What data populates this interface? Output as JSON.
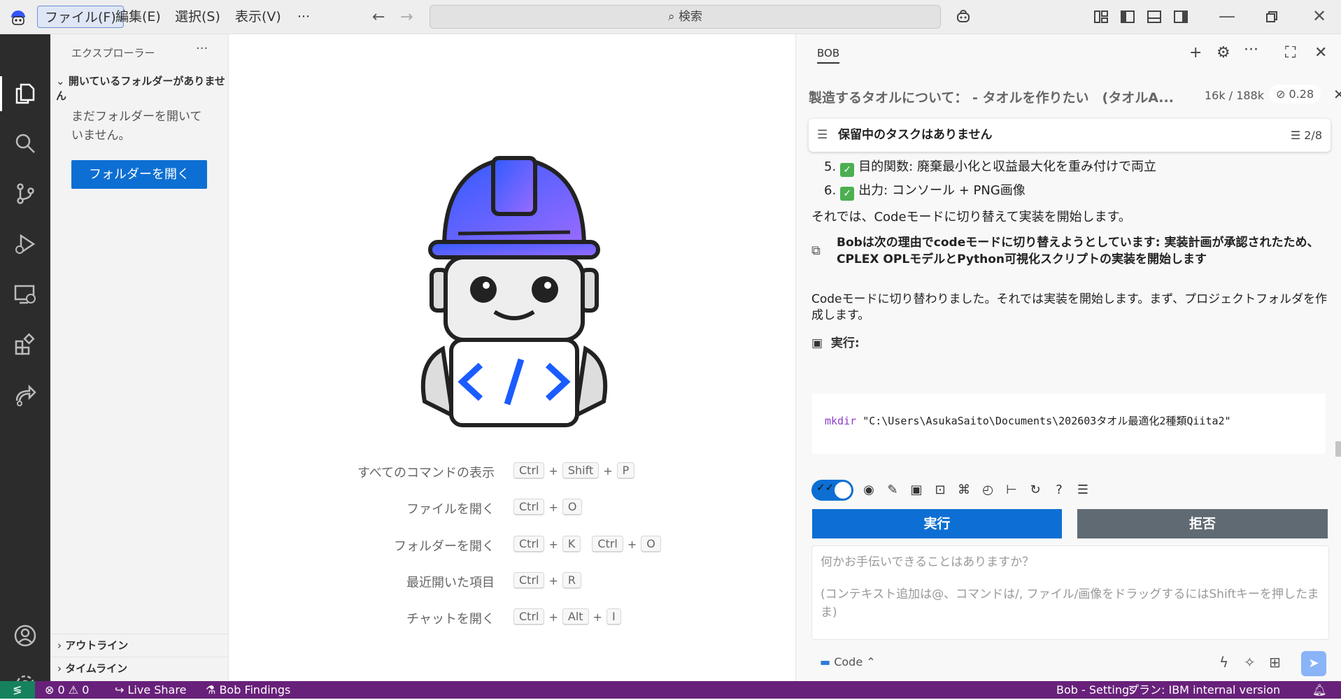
{
  "titlebar": {
    "menus": [
      "ファイル(F)",
      "編集(E)",
      "選択(S)",
      "表示(V)"
    ],
    "more": "···",
    "search_placeholder": "検索"
  },
  "sidebar": {
    "title": "エクスプローラー",
    "more": "···",
    "section": "開いているフォルダーがありません",
    "message": "まだフォルダーを開いていません。",
    "open_folder_button": "フォルダーを開く",
    "outline": "アウトライン",
    "timeline": "タイムライン"
  },
  "editor": {
    "shortcuts": [
      {
        "label": "すべてのコマンドの表示",
        "keys": [
          "Ctrl",
          "+",
          "Shift",
          "+",
          "P"
        ]
      },
      {
        "label": "ファイルを開く",
        "keys": [
          "Ctrl",
          "+",
          "O"
        ]
      },
      {
        "label": "フォルダーを開く",
        "keys": [
          "Ctrl",
          "+",
          "K",
          "Ctrl",
          "+",
          "O"
        ]
      },
      {
        "label": "最近開いた項目",
        "keys": [
          "Ctrl",
          "+",
          "R"
        ]
      },
      {
        "label": "チャットを開く",
        "keys": [
          "Ctrl",
          "+",
          "Alt",
          "+",
          "I"
        ]
      }
    ]
  },
  "panel": {
    "tab": "BOB",
    "task_title": "製造するタオルについて： - タオルを作りたい　(タオルA...",
    "tokens": "16k / 188k",
    "cost": "0.28",
    "pending_label": "保留中のタスクはありません",
    "pending_count": "2/8",
    "list_items": [
      {
        "num": "5.",
        "text": "目的関数: 廃棄最小化と収益最大化を重み付けで両立"
      },
      {
        "num": "6.",
        "text": "出力: コンソール + PNG画像"
      }
    ],
    "msg1": "それでは、Codeモードに切り替えて実装を開始します。",
    "switch_notice": "Bobは次の理由でcodeモードに切り替えようとしています: 実装計画が承認されたため、CPLEX OPLモデルとPython可視化スクリプトの実装を開始します",
    "msg2": "Codeモードに切り替わりました。それでは実装を開始します。まず、プロジェクトフォルダを作成します。",
    "exec_label": "実行:",
    "code_cmd": "mkdir",
    "code_arg": "\"C:\\Users\\AsukaSaito\\Documents\\202603タオル最適化2種類Qiita2\"",
    "run_button": "実行",
    "reject_button": "拒否",
    "input_placeholder_1": "何かお手伝いできることはありますか？",
    "input_placeholder_2": "(コンテキスト追加は@、コマンドは/, ファイル/画像をドラッグするにはShiftキーを押したまま)",
    "mode": "Code"
  },
  "statusbar": {
    "errors": "0",
    "warnings": "0",
    "live_share": "Live Share",
    "bob_findings": "Bob Findings",
    "bob_settings": "Bob - Settings",
    "plan": "プラン: IBM internal version"
  },
  "colors": {
    "accent": "#0d6fd3",
    "statusbar": "#68217a",
    "activitybar": "#2c2c2c"
  }
}
